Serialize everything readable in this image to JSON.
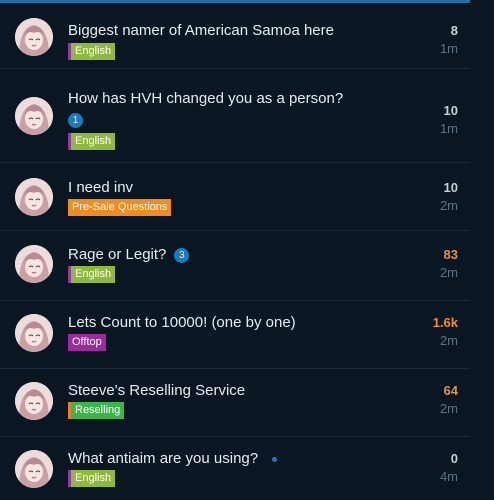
{
  "topics": [
    {
      "title": "Biggest namer of American Samoa here",
      "tag": "English",
      "count": "8",
      "age": "1m",
      "unread": ""
    },
    {
      "title": "How has HVH changed you as a person?",
      "tag": "English",
      "count": "10",
      "age": "1m",
      "unread": "1"
    },
    {
      "title": "I need inv",
      "tag": "Pre-Sale Questions",
      "count": "10",
      "age": "2m",
      "unread": ""
    },
    {
      "title": "Rage or Legit?",
      "tag": "English",
      "count": "83",
      "age": "2m",
      "unread": "3"
    },
    {
      "title": "Lets Count to 10000! (one by one)",
      "tag": "Offtop",
      "count": "1.6k",
      "age": "2m",
      "unread": ""
    },
    {
      "title": "Steeve's Reselling Service",
      "tag": "Reselling",
      "count": "64",
      "age": "2m",
      "unread": ""
    },
    {
      "title": "What antiaim are you using?",
      "tag": "English",
      "count": "0",
      "age": "4m",
      "unread": ""
    }
  ],
  "colors": {
    "background": "#0a1622",
    "accent": "#1b7db8",
    "english_tag": "#8fb83c",
    "presale_tag": "#f28c1f",
    "offtop_tag": "#9b2a9d",
    "reselling_tag": "#3cb44b"
  },
  "icons": {
    "avatar": "anime-avatar-icon",
    "unread_badge": "unread-count-badge",
    "new_dot": "new-topic-dot"
  }
}
